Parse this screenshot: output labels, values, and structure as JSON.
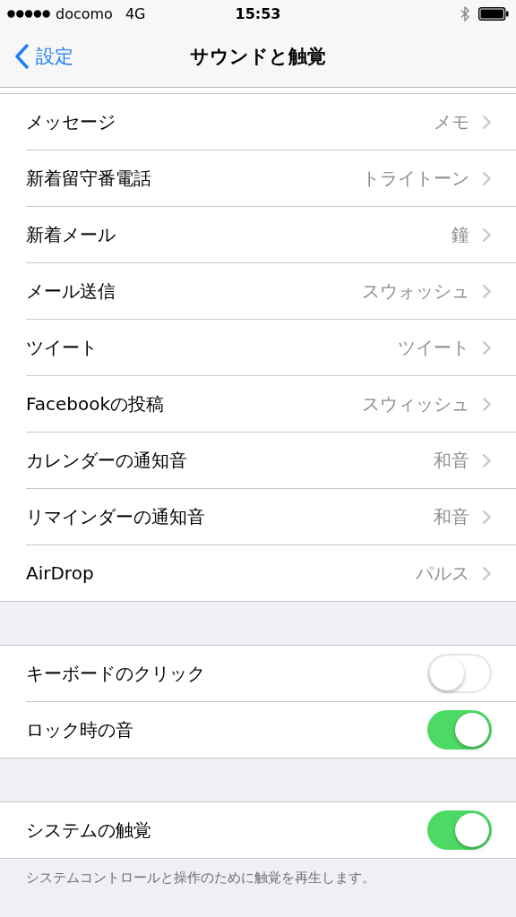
{
  "status_bar": {
    "carrier": "docomo",
    "network": "4G",
    "time": "15:53"
  },
  "nav": {
    "back": "設定",
    "title": "サウンドと触覚"
  },
  "groups": [
    {
      "rows": [
        {
          "kind": "disclosure",
          "label": "メッセージ",
          "value": "メモ"
        },
        {
          "kind": "disclosure",
          "label": "新着留守番電話",
          "value": "トライトーン"
        },
        {
          "kind": "disclosure",
          "label": "新着メール",
          "value": "鐘"
        },
        {
          "kind": "disclosure",
          "label": "メール送信",
          "value": "スウォッシュ"
        },
        {
          "kind": "disclosure",
          "label": "ツイート",
          "value": "ツイート"
        },
        {
          "kind": "disclosure",
          "label": "Facebookの投稿",
          "value": "スウィッシュ"
        },
        {
          "kind": "disclosure",
          "label": "カレンダーの通知音",
          "value": "和音"
        },
        {
          "kind": "disclosure",
          "label": "リマインダーの通知音",
          "value": "和音"
        },
        {
          "kind": "disclosure",
          "label": "AirDrop",
          "value": "パルス"
        }
      ]
    },
    {
      "rows": [
        {
          "kind": "toggle",
          "label": "キーボードのクリック",
          "on": false
        },
        {
          "kind": "toggle",
          "label": "ロック時の音",
          "on": true
        }
      ]
    },
    {
      "rows": [
        {
          "kind": "toggle",
          "label": "システムの触覚",
          "on": true
        }
      ],
      "footer": "システムコントロールと操作のために触覚を再生します。"
    }
  ]
}
